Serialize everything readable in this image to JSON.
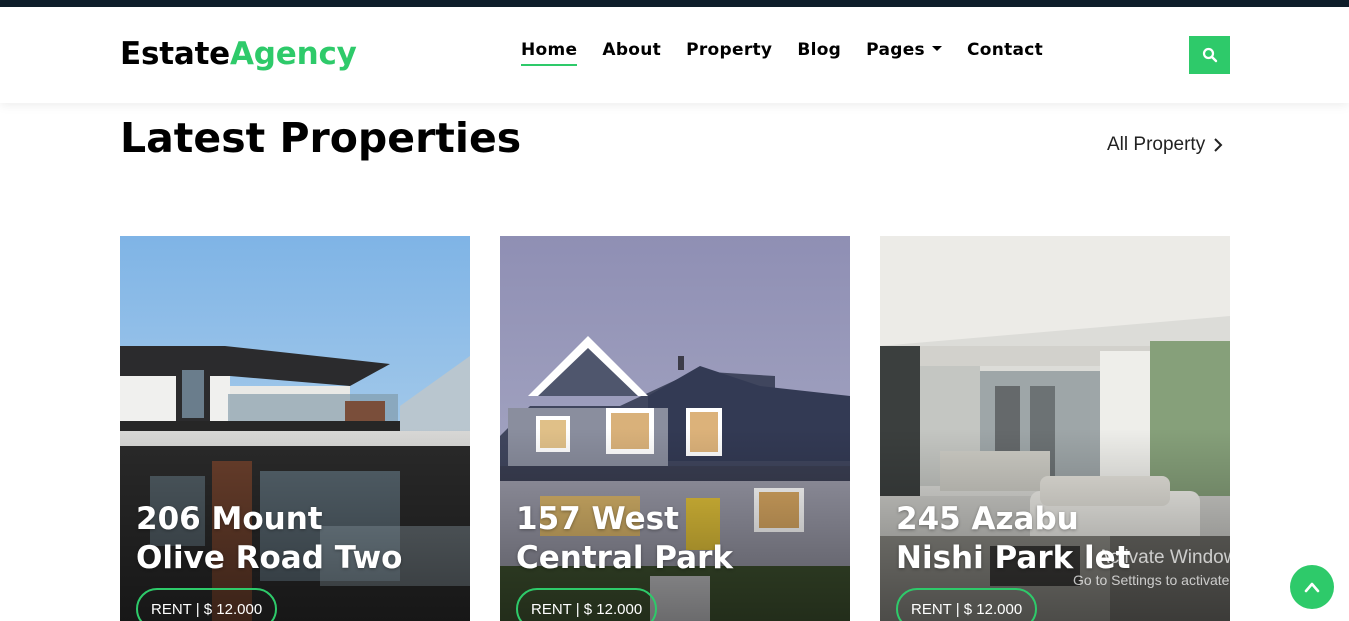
{
  "brand": {
    "part1": "Estate",
    "part2": "Agency"
  },
  "nav": {
    "home": "Home",
    "about": "About",
    "property": "Property",
    "blog": "Blog",
    "pages": "Pages",
    "contact": "Contact"
  },
  "section": {
    "title": "Latest Properties",
    "all_link": "All Property"
  },
  "cards": [
    {
      "line1": "206 Mount",
      "line2": "Olive Road Two",
      "price": "RENT | $ 12.000"
    },
    {
      "line1": "157 West",
      "line2": "Central Park",
      "price": "RENT | $ 12.000"
    },
    {
      "line1": "245 Azabu",
      "line2": "Nishi Park let",
      "price": "RENT | $ 12.000"
    }
  ],
  "watermark": {
    "line1": "Activate Windows",
    "line2": "Go to Settings to activate Windows."
  },
  "colors": {
    "accent": "#2eca6a",
    "topbar": "#0f1f2b"
  },
  "icons": {
    "search": "search-icon",
    "chevron": "chevron-right-icon",
    "back_top": "chevron-up-icon",
    "dropdown": "caret-down-icon"
  }
}
